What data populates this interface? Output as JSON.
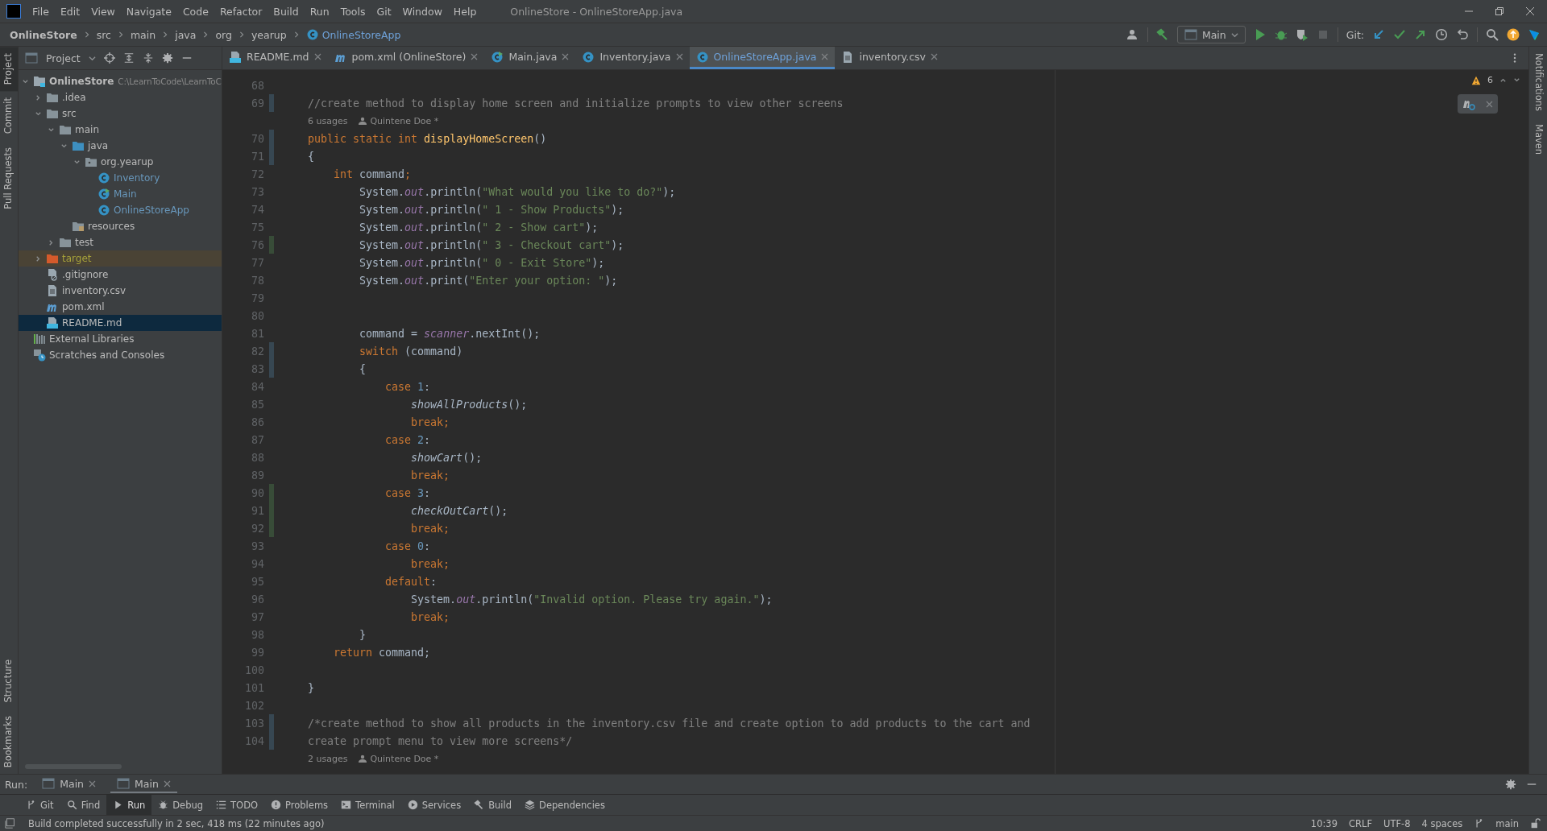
{
  "menu": [
    "File",
    "Edit",
    "View",
    "Navigate",
    "Code",
    "Refactor",
    "Build",
    "Run",
    "Tools",
    "Git",
    "Window",
    "Help"
  ],
  "window": {
    "title": "OnlineStore - OnlineStoreApp.java"
  },
  "breadcrumbs": [
    "OnlineStore",
    "src",
    "main",
    "java",
    "org",
    "yearup",
    "OnlineStoreApp"
  ],
  "toolbar": {
    "run_config": "Main",
    "git_label": "Git:"
  },
  "left_strip_top": [
    {
      "label": "Project",
      "selected": true
    },
    {
      "label": "Commit",
      "selected": false
    },
    {
      "label": "Pull Requests",
      "selected": false
    }
  ],
  "left_strip_bottom": [
    {
      "label": "Structure",
      "selected": false
    },
    {
      "label": "Bookmarks",
      "selected": false
    }
  ],
  "right_strip": [
    {
      "label": "Notifications",
      "selected": false
    },
    {
      "label": "Maven",
      "selected": false
    }
  ],
  "project_panel": {
    "title": "Project"
  },
  "tree": [
    {
      "label": "OnlineStore",
      "path": "C:\\LearnToCode\\LearnToC",
      "kind": "module",
      "expanded": true,
      "selected": false,
      "children": [
        {
          "label": ".idea",
          "kind": "folder",
          "expanded": false,
          "selected": false
        },
        {
          "label": "src",
          "kind": "folder",
          "expanded": true,
          "selected": false,
          "children": [
            {
              "label": "main",
              "kind": "folder",
              "expanded": true,
              "selected": false,
              "children": [
                {
                  "label": "java",
                  "kind": "source-folder",
                  "expanded": true,
                  "selected": false,
                  "children": [
                    {
                      "label": "org.yearup",
                      "kind": "package",
                      "expanded": true,
                      "selected": false,
                      "children": [
                        {
                          "label": "Inventory",
                          "kind": "class",
                          "selected": false
                        },
                        {
                          "label": "Main",
                          "kind": "main-class",
                          "selected": false
                        },
                        {
                          "label": "OnlineStoreApp",
                          "kind": "class",
                          "selected": false
                        }
                      ]
                    }
                  ]
                },
                {
                  "label": "resources",
                  "kind": "resources",
                  "selected": false
                }
              ]
            },
            {
              "label": "test",
              "kind": "folder",
              "expanded": false,
              "selected": false
            }
          ]
        },
        {
          "label": "target",
          "kind": "excluded-folder",
          "expanded": false,
          "selected": false
        },
        {
          "label": ".gitignore",
          "kind": "ignore-file",
          "selected": false
        },
        {
          "label": "inventory.csv",
          "kind": "text-file",
          "selected": false
        },
        {
          "label": "pom.xml",
          "kind": "maven",
          "selected": false
        },
        {
          "label": "README.md",
          "kind": "markdown",
          "selected": true
        }
      ]
    },
    {
      "label": "External Libraries",
      "kind": "libraries",
      "selected": false
    },
    {
      "label": "Scratches and Consoles",
      "kind": "scratches",
      "selected": false
    }
  ],
  "tabs": [
    {
      "label": "README.md",
      "kind": "markdown",
      "selected": false
    },
    {
      "label": "pom.xml (OnlineStore)",
      "kind": "maven",
      "selected": false
    },
    {
      "label": "Main.java",
      "kind": "main-class",
      "selected": false
    },
    {
      "label": "Inventory.java",
      "kind": "class",
      "selected": false
    },
    {
      "label": "OnlineStoreApp.java",
      "kind": "class",
      "selected": true
    },
    {
      "label": "inventory.csv",
      "kind": "text-file",
      "selected": false
    }
  ],
  "warnings": "6",
  "code": [
    {
      "kind": "line",
      "number": "68"
    },
    {
      "kind": "line",
      "number": "69",
      "tokens": [
        {
          "kind": "comment",
          "text": "//create method to display home screen and initialize prompts to view other screens"
        }
      ]
    },
    {
      "kind": "hint",
      "usages": "6 usages",
      "author": "Quintene Doe *"
    },
    {
      "kind": "line",
      "number": "70",
      "tokens": [
        {
          "kind": "keyword",
          "text": "public static int "
        },
        {
          "kind": "decl",
          "text": "displayHomeScreen"
        },
        {
          "kind": "plain",
          "text": "()"
        }
      ]
    },
    {
      "kind": "line",
      "number": "71",
      "tokens": [
        {
          "kind": "plain",
          "text": "{"
        }
      ]
    },
    {
      "kind": "line",
      "number": "72",
      "tokens": [
        {
          "kind": "keyword",
          "text": "    int "
        },
        {
          "kind": "plain",
          "text": "command"
        },
        {
          "kind": "keyword",
          "text": ";"
        }
      ]
    },
    {
      "kind": "line",
      "number": "73",
      "tokens": [
        {
          "kind": "plain",
          "text": "        System."
        },
        {
          "kind": "field",
          "text": "out"
        },
        {
          "kind": "plain",
          "text": ".println("
        },
        {
          "kind": "string",
          "text": "\"What would you like to do?\""
        },
        {
          "kind": "plain",
          "text": ");"
        }
      ]
    },
    {
      "kind": "line",
      "number": "74",
      "tokens": [
        {
          "kind": "plain",
          "text": "        System."
        },
        {
          "kind": "field",
          "text": "out"
        },
        {
          "kind": "plain",
          "text": ".println("
        },
        {
          "kind": "string",
          "text": "\" 1 - Show Products\""
        },
        {
          "kind": "plain",
          "text": ");"
        }
      ]
    },
    {
      "kind": "line",
      "number": "75",
      "tokens": [
        {
          "kind": "plain",
          "text": "        System."
        },
        {
          "kind": "field",
          "text": "out"
        },
        {
          "kind": "plain",
          "text": ".println("
        },
        {
          "kind": "string",
          "text": "\" 2 - Show cart\""
        },
        {
          "kind": "plain",
          "text": ");"
        }
      ]
    },
    {
      "kind": "line",
      "number": "76",
      "tokens": [
        {
          "kind": "plain",
          "text": "        System."
        },
        {
          "kind": "field",
          "text": "out"
        },
        {
          "kind": "plain",
          "text": ".println("
        },
        {
          "kind": "string",
          "text": "\" 3 - Checkout cart\""
        },
        {
          "kind": "plain",
          "text": ");"
        }
      ]
    },
    {
      "kind": "line",
      "number": "77",
      "tokens": [
        {
          "kind": "plain",
          "text": "        System."
        },
        {
          "kind": "field",
          "text": "out"
        },
        {
          "kind": "plain",
          "text": ".println("
        },
        {
          "kind": "string",
          "text": "\" 0 - Exit Store\""
        },
        {
          "kind": "plain",
          "text": ");"
        }
      ]
    },
    {
      "kind": "line",
      "number": "78",
      "tokens": [
        {
          "kind": "plain",
          "text": "        System."
        },
        {
          "kind": "field",
          "text": "out"
        },
        {
          "kind": "plain",
          "text": ".print("
        },
        {
          "kind": "string",
          "text": "\"Enter your option: \""
        },
        {
          "kind": "plain",
          "text": ");"
        }
      ]
    },
    {
      "kind": "line",
      "number": "79"
    },
    {
      "kind": "line",
      "number": "80"
    },
    {
      "kind": "line",
      "number": "81",
      "tokens": [
        {
          "kind": "plain",
          "text": "        command = "
        },
        {
          "kind": "field",
          "text": "scanner"
        },
        {
          "kind": "plain",
          "text": ".nextInt();"
        }
      ]
    },
    {
      "kind": "line",
      "number": "82",
      "tokens": [
        {
          "kind": "keyword",
          "text": "        switch "
        },
        {
          "kind": "plain",
          "text": "(command)"
        }
      ]
    },
    {
      "kind": "line",
      "number": "83",
      "tokens": [
        {
          "kind": "plain",
          "text": "        {"
        }
      ]
    },
    {
      "kind": "line",
      "number": "84",
      "tokens": [
        {
          "kind": "keyword",
          "text": "            case "
        },
        {
          "kind": "number",
          "text": "1"
        },
        {
          "kind": "plain",
          "text": ":"
        }
      ]
    },
    {
      "kind": "line",
      "number": "85",
      "tokens": [
        {
          "kind": "call",
          "text": "                showAllProducts"
        },
        {
          "kind": "plain",
          "text": "();"
        }
      ]
    },
    {
      "kind": "line",
      "number": "86",
      "tokens": [
        {
          "kind": "keyword",
          "text": "                break;"
        }
      ]
    },
    {
      "kind": "line",
      "number": "87",
      "tokens": [
        {
          "kind": "keyword",
          "text": "            case "
        },
        {
          "kind": "number",
          "text": "2"
        },
        {
          "kind": "plain",
          "text": ":"
        }
      ]
    },
    {
      "kind": "line",
      "number": "88",
      "tokens": [
        {
          "kind": "call",
          "text": "                showCart"
        },
        {
          "kind": "plain",
          "text": "();"
        }
      ]
    },
    {
      "kind": "line",
      "number": "89",
      "tokens": [
        {
          "kind": "keyword",
          "text": "                break;"
        }
      ]
    },
    {
      "kind": "line",
      "number": "90",
      "tokens": [
        {
          "kind": "keyword",
          "text": "            case "
        },
        {
          "kind": "number",
          "text": "3"
        },
        {
          "kind": "plain",
          "text": ":"
        }
      ]
    },
    {
      "kind": "line",
      "number": "91",
      "tokens": [
        {
          "kind": "call",
          "text": "                checkOutCart"
        },
        {
          "kind": "plain",
          "text": "();"
        }
      ]
    },
    {
      "kind": "line",
      "number": "92",
      "tokens": [
        {
          "kind": "keyword",
          "text": "                break;"
        }
      ]
    },
    {
      "kind": "line",
      "number": "93",
      "tokens": [
        {
          "kind": "keyword",
          "text": "            case "
        },
        {
          "kind": "number",
          "text": "0"
        },
        {
          "kind": "plain",
          "text": ":"
        }
      ]
    },
    {
      "kind": "line",
      "number": "94",
      "tokens": [
        {
          "kind": "keyword",
          "text": "                break;"
        }
      ]
    },
    {
      "kind": "line",
      "number": "95",
      "tokens": [
        {
          "kind": "keyword",
          "text": "            default"
        },
        {
          "kind": "plain",
          "text": ":"
        }
      ]
    },
    {
      "kind": "line",
      "number": "96",
      "tokens": [
        {
          "kind": "plain",
          "text": "                System."
        },
        {
          "kind": "field",
          "text": "out"
        },
        {
          "kind": "plain",
          "text": ".println("
        },
        {
          "kind": "string",
          "text": "\"Invalid option. Please try again.\""
        },
        {
          "kind": "plain",
          "text": ");"
        }
      ]
    },
    {
      "kind": "line",
      "number": "97",
      "tokens": [
        {
          "kind": "keyword",
          "text": "                break;"
        }
      ]
    },
    {
      "kind": "line",
      "number": "98",
      "tokens": [
        {
          "kind": "plain",
          "text": "        }"
        }
      ]
    },
    {
      "kind": "line",
      "number": "99",
      "tokens": [
        {
          "kind": "keyword",
          "text": "    return "
        },
        {
          "kind": "plain",
          "text": "command;"
        }
      ]
    },
    {
      "kind": "line",
      "number": "100"
    },
    {
      "kind": "line",
      "number": "101",
      "tokens": [
        {
          "kind": "plain",
          "text": "}"
        }
      ]
    },
    {
      "kind": "line",
      "number": "102"
    },
    {
      "kind": "line",
      "number": "103",
      "tokens": [
        {
          "kind": "comment",
          "text": "/*create method to show all products in the inventory.csv file and create option to add products to the cart and"
        }
      ]
    },
    {
      "kind": "line",
      "number": "104",
      "tokens": [
        {
          "kind": "comment",
          "text": "create prompt menu to view more screens*/"
        }
      ]
    },
    {
      "kind": "hint",
      "usages": "2 usages",
      "author": "Quintene Doe *"
    }
  ],
  "run_bar": {
    "label": "Run:",
    "tabs": [
      {
        "label": "Main",
        "selected": false
      },
      {
        "label": "Main",
        "selected": true
      }
    ]
  },
  "tool_tabs": [
    {
      "label": "Git",
      "kind": "git",
      "selected": false
    },
    {
      "label": "Find",
      "kind": "search",
      "selected": false
    },
    {
      "label": "Run",
      "kind": "run",
      "selected": true
    },
    {
      "label": "Debug",
      "kind": "bug",
      "selected": false
    },
    {
      "label": "TODO",
      "kind": "list",
      "selected": false
    },
    {
      "label": "Problems",
      "kind": "info",
      "selected": false
    },
    {
      "label": "Terminal",
      "kind": "terminal",
      "selected": false
    },
    {
      "label": "Services",
      "kind": "services",
      "selected": false
    },
    {
      "label": "Build",
      "kind": "hammer",
      "selected": false
    },
    {
      "label": "Dependencies",
      "kind": "layers",
      "selected": false
    }
  ],
  "status_bar": {
    "message": "Build completed successfully in 2 sec, 418 ms (22 minutes ago)",
    "position": "10:39",
    "line_separator": "CRLF",
    "encoding": "UTF-8",
    "indent": "4 spaces",
    "branch": "main"
  }
}
